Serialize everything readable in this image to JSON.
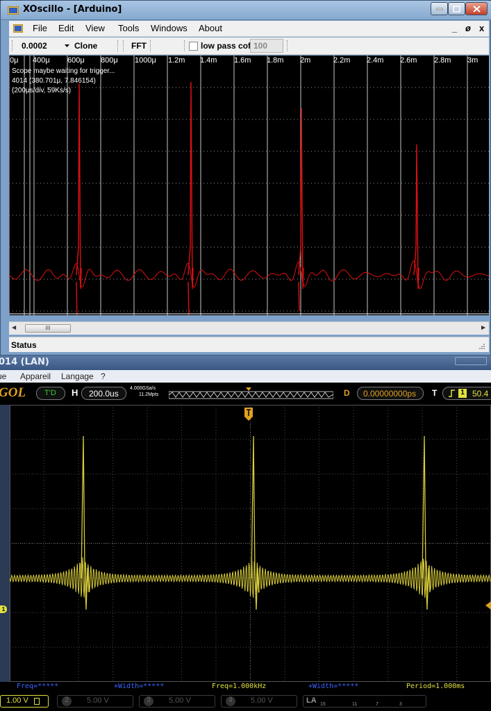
{
  "xoscillo": {
    "title": "XOscillo - [Arduino]",
    "menus": [
      "File",
      "Edit",
      "View",
      "Tools",
      "Windows",
      "About"
    ],
    "mdi_controls": [
      "_",
      "ø",
      "x"
    ],
    "toolbar": {
      "timebase_value": "0.0002",
      "device_value": "Clone",
      "fft_label": "FFT",
      "low_pass_label": "low pass cof",
      "low_pass_checked": false,
      "low_pass_value": "100"
    },
    "scope": {
      "x_ticks": [
        "0μ",
        "400μ",
        "600μ",
        "800μ",
        "1000μ",
        "1.2m",
        "1.4m",
        "1.6m",
        "1.8m",
        "2m",
        "2.2m",
        "2.4m",
        "2.6m",
        "2.8m",
        "3m"
      ],
      "info_lines": [
        "Scope maybe waiting for trigger...",
        "4014 (380.701μ, 7.846154)",
        "(200μs/div, 59Ks/s)"
      ],
      "trace_color": "#e01010",
      "background": "#000000",
      "grid_color": "#c8c8c8"
    },
    "scrollbar": {
      "thumb_grip": "III"
    },
    "status": "Status"
  },
  "rigol": {
    "title": "014 (LAN)",
    "menus": [
      "ue",
      "Appareil",
      "Langage",
      "?"
    ],
    "brand": "GOL",
    "run_status": "T'D",
    "h_label": "H",
    "timebase": "200.0us",
    "sample_rate": "4.000GSa/s",
    "memory_depth": "11.2Mpts",
    "d_label": "D",
    "delay": "0.00000000ps",
    "t_label": "T",
    "trigger_level": "50.4",
    "trigger_channel": "1",
    "channel_marker": "1",
    "measurements": [
      "Freq=*****",
      "+Width=*****",
      "Freq=1.000kHz",
      "+Width=*****",
      "Period=1.000ms"
    ],
    "channels": [
      {
        "num": "1",
        "scale": "1.00 V",
        "active": true
      },
      {
        "num": "2",
        "scale": "5.00 V",
        "active": false
      },
      {
        "num": "3",
        "scale": "5.00 V",
        "active": false
      },
      {
        "num": "4",
        "scale": "5.00 V",
        "active": false
      }
    ],
    "la_label": "LA",
    "la_numbers": [
      "15",
      "11",
      "7",
      "3"
    ],
    "trace_color": "#d8cc3a",
    "grid_color": "#4a4a4a"
  }
}
